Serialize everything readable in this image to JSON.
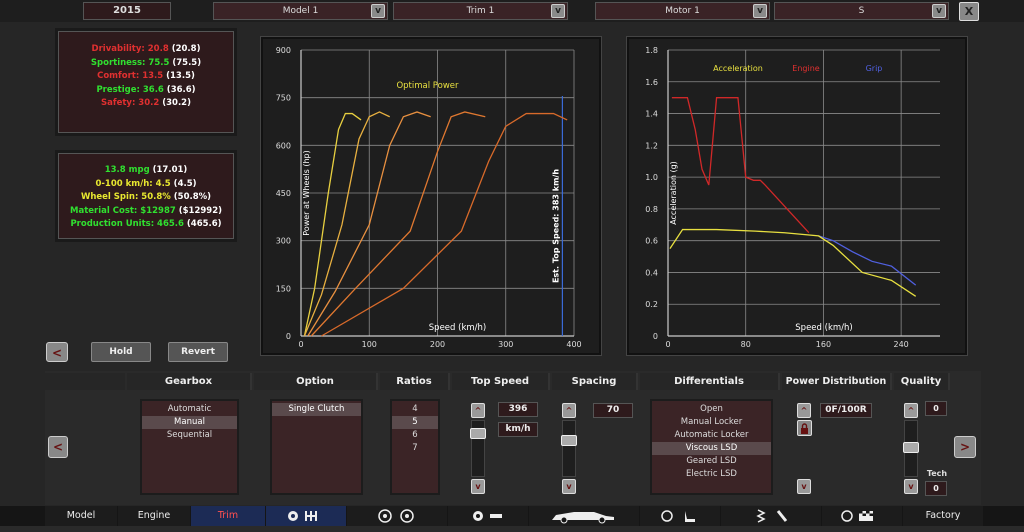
{
  "top": {
    "year": "2015",
    "model": "Model 1",
    "trim": "Trim 1",
    "motor": "Motor 1",
    "variant": "S",
    "dropdown_glyph": "v",
    "close_glyph": "X"
  },
  "ratings": [
    {
      "label": "Drivability:",
      "value": "20.8",
      "paren": "(20.8)",
      "color": "#e03030"
    },
    {
      "label": "Sportiness:",
      "value": "75.5",
      "paren": "(75.5)",
      "color": "#30e030"
    },
    {
      "label": "Comfort:",
      "value": "13.5",
      "paren": "(13.5)",
      "color": "#e03030"
    },
    {
      "label": "Prestige:",
      "value": "36.6",
      "paren": "(36.6)",
      "color": "#30e030"
    },
    {
      "label": "Safety:",
      "value": "30.2",
      "paren": "(30.2)",
      "color": "#e03030"
    }
  ],
  "stats": [
    {
      "text": "13.8 mpg",
      "paren": "(17.01)",
      "color": "#30e030"
    },
    {
      "text": "0-100 km/h: 4.5",
      "paren": "(4.5)",
      "color": "#e8e830"
    },
    {
      "text": "Wheel Spin: 50.8%",
      "paren": "(50.8%)",
      "color": "#e8e830"
    },
    {
      "text": "Material Cost: $12987",
      "paren": "($12992)",
      "color": "#30e030"
    },
    {
      "text": "Production Units: 465.6",
      "paren": "(465.6)",
      "color": "#30e030"
    }
  ],
  "buttons": {
    "hold": "Hold",
    "revert": "Revert",
    "back": "<",
    "next": ">"
  },
  "chart_data": [
    {
      "type": "line",
      "title": "Optimal Power",
      "xlabel": "Speed (km/h)",
      "ylabel": "Power at Wheels (hp)",
      "xlim": [
        0,
        400
      ],
      "ylim": [
        0,
        900
      ],
      "xticks": [
        "0",
        "100",
        "200",
        "300",
        "400"
      ],
      "yticks": [
        "0",
        "150",
        "300",
        "450",
        "600",
        "750",
        "900"
      ],
      "grid": true,
      "top_speed_label": "Est. Top Speed: 383 km/h",
      "top_speed": 383,
      "series": [
        {
          "x": [
            5,
            20,
            40,
            55,
            65,
            75,
            88
          ],
          "y": [
            0,
            150,
            450,
            650,
            700,
            700,
            680
          ],
          "color": "#e8d040"
        },
        {
          "x": [
            5,
            30,
            60,
            85,
            100,
            115,
            130
          ],
          "y": [
            0,
            130,
            350,
            620,
            690,
            705,
            690
          ],
          "color": "#e8b040"
        },
        {
          "x": [
            10,
            50,
            100,
            130,
            150,
            170,
            190
          ],
          "y": [
            0,
            140,
            350,
            600,
            690,
            705,
            690
          ],
          "color": "#e89040"
        },
        {
          "x": [
            15,
            80,
            160,
            200,
            220,
            240,
            270
          ],
          "y": [
            0,
            150,
            330,
            580,
            690,
            705,
            690
          ],
          "color": "#e07830"
        },
        {
          "x": [
            30,
            150,
            235,
            275,
            300,
            330,
            370,
            390
          ],
          "y": [
            0,
            150,
            330,
            550,
            660,
            700,
            700,
            680
          ],
          "color": "#d86a2a"
        }
      ]
    },
    {
      "type": "line",
      "xlabel": "Speed (km/h)",
      "ylabel": "Acceleration (g)",
      "xlim": [
        0,
        280
      ],
      "ylim": [
        0,
        1.8
      ],
      "xticks": [
        "0",
        "80",
        "160",
        "240"
      ],
      "yticks": [
        "0",
        "0.2",
        "0.4",
        "0.6",
        "0.8",
        "1.0",
        "1.2",
        "1.4",
        "1.6",
        "1.8"
      ],
      "grid": true,
      "legend": [
        {
          "name": "Acceleration",
          "color": "#e8e040"
        },
        {
          "name": "Engine",
          "color": "#e03030"
        },
        {
          "name": "Grip",
          "color": "#5060e0"
        }
      ],
      "series": [
        {
          "name": "Engine",
          "color": "#d02828",
          "x": [
            4,
            20,
            28,
            35,
            42,
            50,
            60,
            72,
            80,
            88,
            95,
            100,
            115,
            130,
            145
          ],
          "y": [
            1.5,
            1.5,
            1.3,
            1.05,
            0.95,
            1.5,
            1.5,
            1.5,
            1.0,
            0.98,
            0.98,
            0.95,
            0.85,
            0.75,
            0.65
          ]
        },
        {
          "name": "Grip",
          "color": "#5060e0",
          "x": [
            155,
            170,
            190,
            210,
            230,
            255
          ],
          "y": [
            0.63,
            0.6,
            0.53,
            0.47,
            0.44,
            0.32
          ]
        },
        {
          "name": "Acceleration",
          "color": "#e8e040",
          "x": [
            2,
            15,
            50,
            90,
            120,
            155,
            170,
            200,
            230,
            255
          ],
          "y": [
            0.55,
            0.67,
            0.67,
            0.66,
            0.65,
            0.63,
            0.57,
            0.4,
            0.35,
            0.25
          ]
        }
      ]
    }
  ],
  "bottom": {
    "headers": {
      "gearbox": "Gearbox",
      "option": "Option",
      "ratios": "Ratios",
      "top_speed": "Top Speed",
      "spacing": "Spacing",
      "differentials": "Differentials",
      "power_distribution": "Power Distribution",
      "quality": "Quality"
    },
    "gearbox_items": [
      "Automatic",
      "Manual",
      "Sequential"
    ],
    "gearbox_selected": 1,
    "option_items": [
      "Single Clutch"
    ],
    "option_selected": 0,
    "ratio_items": [
      "4",
      "5",
      "6",
      "7"
    ],
    "ratio_selected": 1,
    "top_speed_value": "396",
    "top_speed_unit": "km/h",
    "spacing_value": "70",
    "diff_items": [
      "Open",
      "Manual Locker",
      "Automatic Locker",
      "Viscous LSD",
      "Geared LSD",
      "Electric LSD"
    ],
    "diff_selected": 3,
    "power_dist_value": "0F/100R",
    "quality_value": "0",
    "tech_label": "Tech",
    "tech_value": "0",
    "up_glyph": "^",
    "down_glyph": "v"
  },
  "nav": {
    "model": "Model",
    "engine": "Engine",
    "trim": "Trim",
    "factory": "Factory"
  }
}
